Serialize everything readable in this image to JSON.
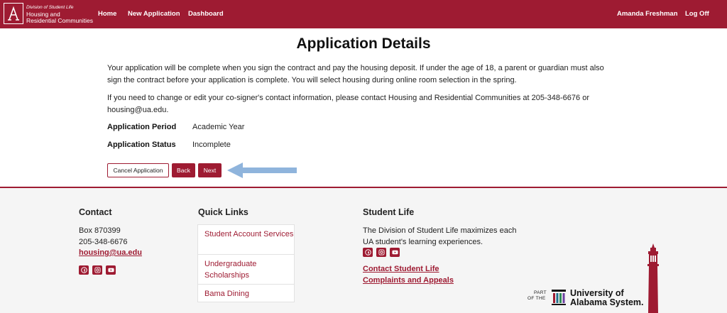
{
  "header": {
    "logo_subtitle": "Division of Student Life",
    "logo_line1": "Housing and",
    "logo_line2": "Residential Communities",
    "nav": {
      "home": "Home",
      "new_application": "New Application",
      "dashboard": "Dashboard"
    },
    "user_name": "Amanda Freshman",
    "log_off": "Log Off"
  },
  "main": {
    "title": "Application Details",
    "para1": "Your application will be complete when you sign the contract and pay the housing deposit. If under the age of 18, a parent or guardian must also sign the contract before your application is complete. You will select housing during online room selection in the spring.",
    "para2": "If you need to change or edit your co-signer's contact information, please contact Housing and Residential Communities at 205-348-6676 or housing@ua.edu.",
    "period_label": "Application Period",
    "period_value": "Academic Year",
    "status_label": "Application Status",
    "status_value": "Incomplete",
    "buttons": {
      "cancel": "Cancel Application",
      "back": "Back",
      "next": "Next"
    }
  },
  "footer": {
    "contact": {
      "heading": "Contact",
      "box": "Box 870399",
      "phone": "205-348-6676",
      "email": "housing@ua.edu"
    },
    "quick_links": {
      "heading": "Quick Links",
      "items": [
        "Student Account Services",
        "Undergraduate Scholarships",
        "Bama Dining"
      ]
    },
    "student_life": {
      "heading": "Student Life",
      "description": "The Division of Student Life maximizes each UA student's learning experiences.",
      "links": [
        "Contact Student Life",
        "Complaints and Appeals"
      ]
    },
    "system": {
      "part_line1": "PART",
      "part_line2": "OF THE",
      "name_line1": "University of",
      "name_line2": "Alabama System."
    }
  },
  "colors": {
    "brand": "#9e1b32",
    "arrow": "#8fb4dc",
    "footer_bg": "#f5f5f5"
  },
  "icons": [
    "script-a-logo-icon",
    "facebook-icon",
    "instagram-icon",
    "youtube-icon",
    "denny-chimes-tower-icon",
    "ua-system-logo-icon",
    "left-arrow-icon"
  ]
}
